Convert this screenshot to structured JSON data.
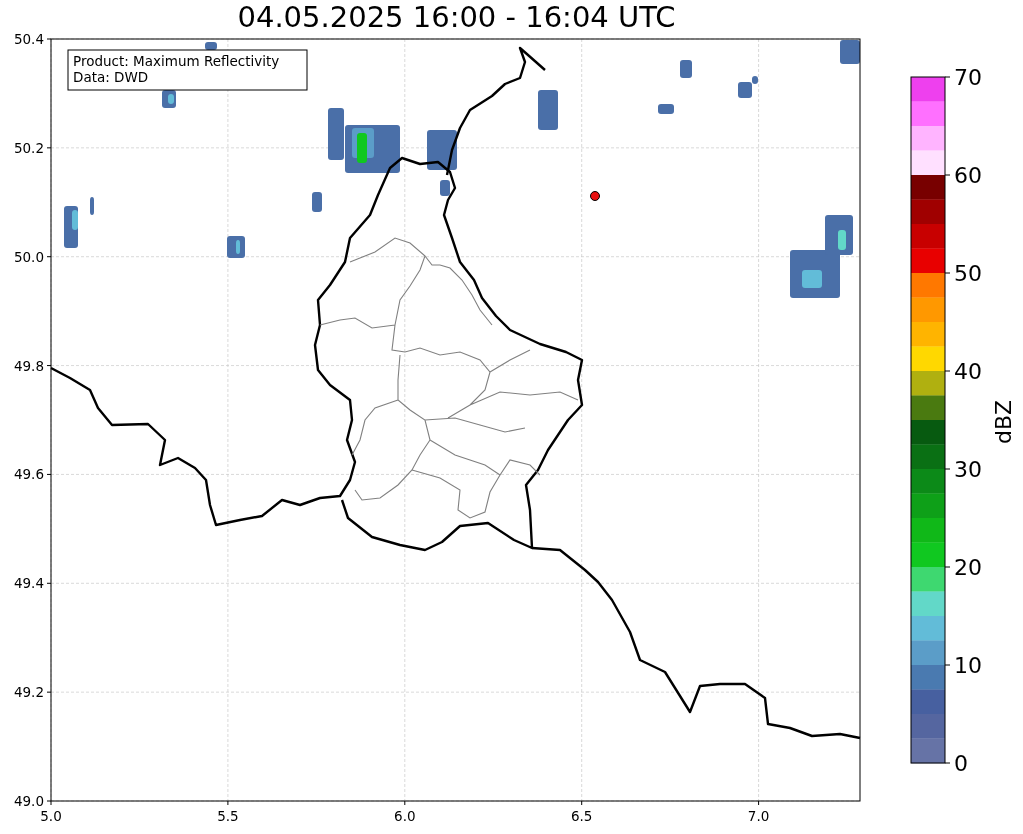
{
  "title": "04.05.2025 16:00 - 16:04 UTC",
  "map": {
    "legend": [
      "Product: Maximum Reflectivity",
      "Data: DWD"
    ],
    "xticks": [
      "5.0",
      "5.5",
      "6.0",
      "6.5",
      "7.0"
    ],
    "yticks": [
      "50.4",
      "50.2",
      "50.0",
      "49.8",
      "49.6",
      "49.4",
      "49.2",
      "49.0"
    ]
  },
  "colorbar": {
    "label": "dBZ",
    "ticks": [
      "70",
      "60",
      "50",
      "40",
      "30",
      "20",
      "10",
      "0"
    ],
    "segments": [
      {
        "color": "#ee40ee"
      },
      {
        "color": "#ff70ff"
      },
      {
        "color": "#ffb4ff"
      },
      {
        "color": "#ffe0ff"
      },
      {
        "color": "#780000"
      },
      {
        "color": "#a00000"
      },
      {
        "color": "#c80000"
      },
      {
        "color": "#e80000"
      },
      {
        "color": "#ff7800"
      },
      {
        "color": "#ff9800"
      },
      {
        "color": "#ffb400"
      },
      {
        "color": "#ffd800"
      },
      {
        "color": "#b0b010"
      },
      {
        "color": "#4a7a10"
      },
      {
        "color": "#075a10"
      },
      {
        "color": "#0a7014"
      },
      {
        "color": "#0c8a18"
      },
      {
        "color": "#0ea018"
      },
      {
        "color": "#10b818"
      },
      {
        "color": "#10c820"
      },
      {
        "color": "#3ed870"
      },
      {
        "color": "#62d8c8"
      },
      {
        "color": "#62bcd8"
      },
      {
        "color": "#5b9dc8"
      },
      {
        "color": "#4a7ab0"
      },
      {
        "color": "#4760a0"
      },
      {
        "color": "#5566a0"
      },
      {
        "color": "#6673a6"
      }
    ]
  }
}
